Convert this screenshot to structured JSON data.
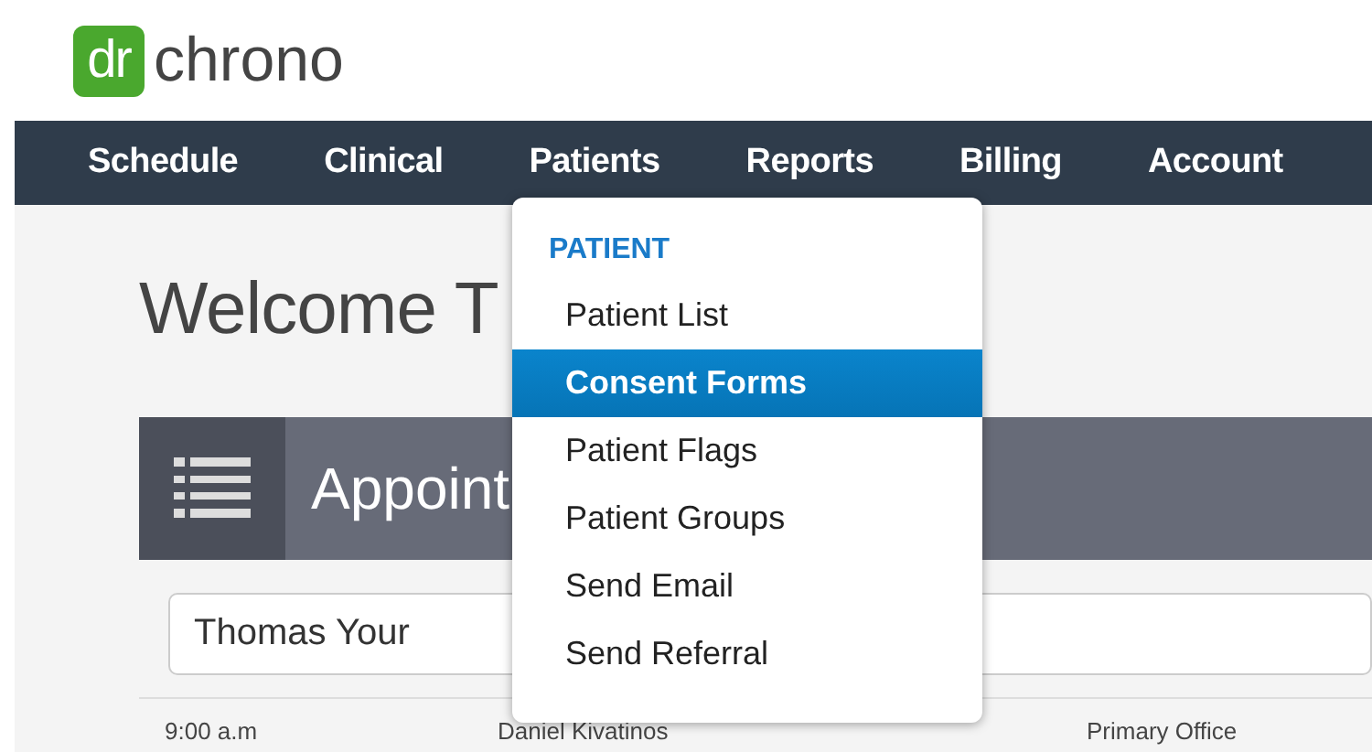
{
  "logo": {
    "mark": "dr",
    "name": "chrono"
  },
  "nav": [
    "Schedule",
    "Clinical",
    "Patients",
    "Reports",
    "Billing",
    "Account"
  ],
  "heading": "Welcome T",
  "panel": {
    "title": "Appoint",
    "search": {
      "value": "Thomas Your"
    },
    "row": [
      "9:00 a.m",
      "Daniel Kivatinos",
      "Primary Office"
    ]
  },
  "menu": {
    "header": "PATIENT",
    "items": [
      {
        "label": "Patient List",
        "selected": false
      },
      {
        "label": "Consent Forms",
        "selected": true
      },
      {
        "label": "Patient Flags",
        "selected": false
      },
      {
        "label": "Patient Groups",
        "selected": false
      },
      {
        "label": "Send Email",
        "selected": false
      },
      {
        "label": "Send Referral",
        "selected": false
      }
    ]
  }
}
